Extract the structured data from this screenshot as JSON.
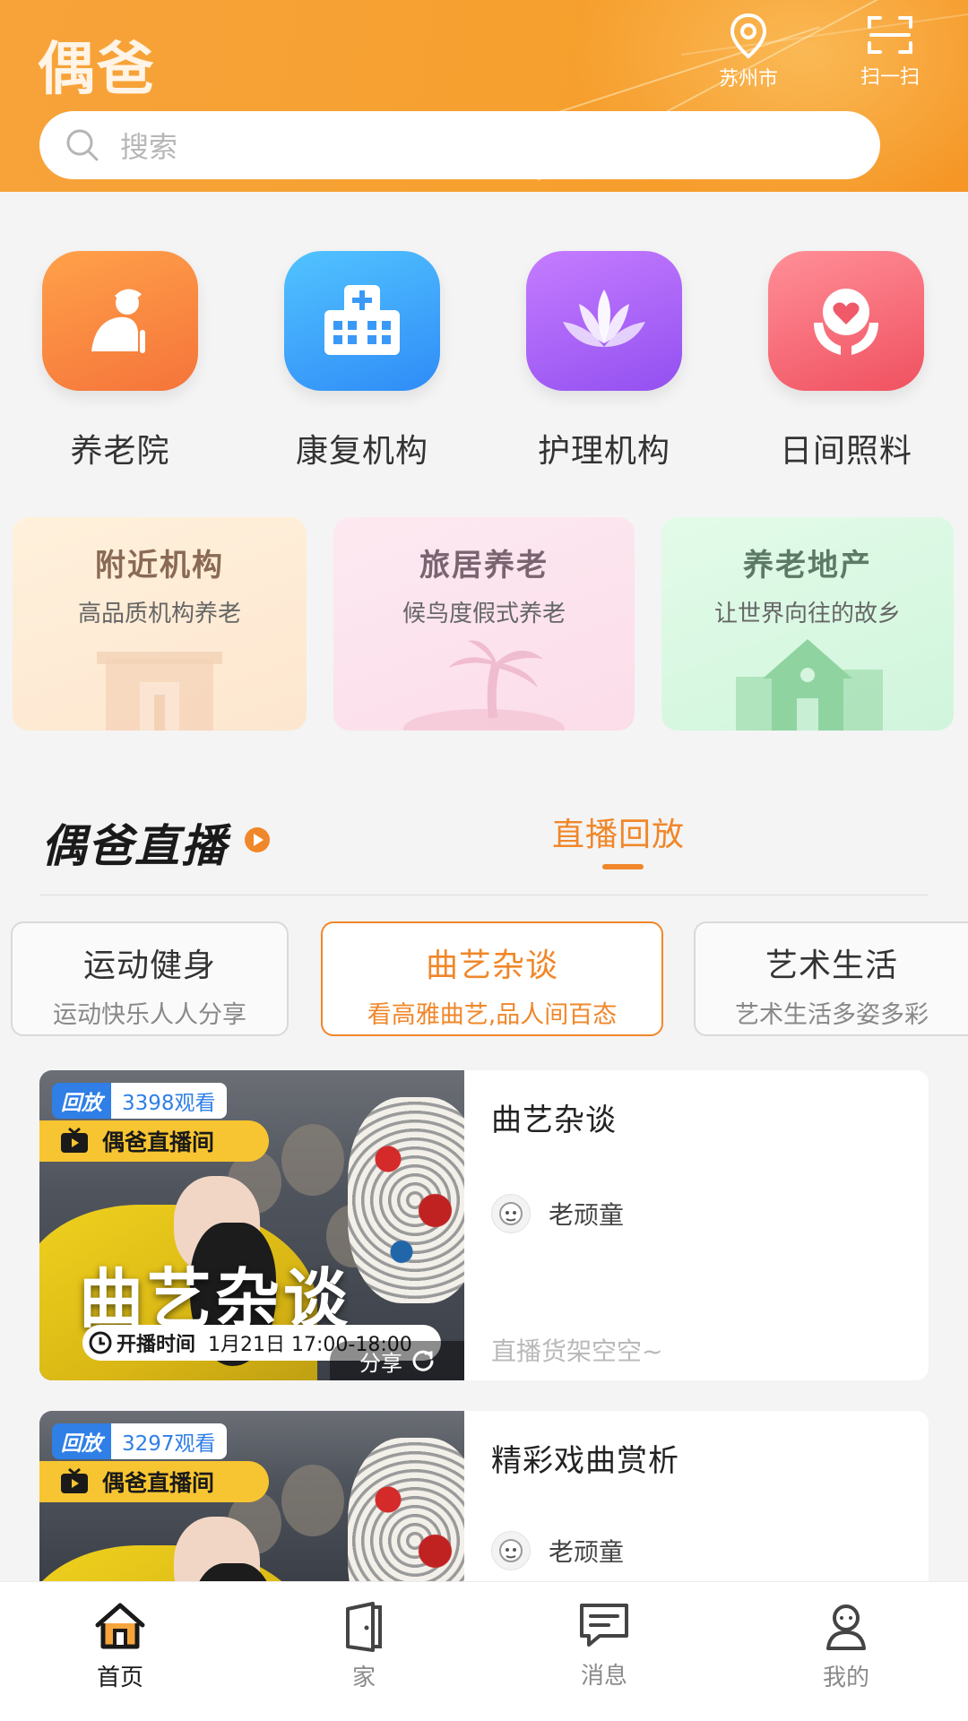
{
  "header": {
    "app_title": "偶爸",
    "location_label": "苏州市",
    "scan_label": "扫一扫",
    "search_placeholder": "搜索"
  },
  "categories": [
    {
      "label": "养老院",
      "icon": "elderly-person-icon"
    },
    {
      "label": "康复机构",
      "icon": "hospital-icon"
    },
    {
      "label": "护理机构",
      "icon": "lotus-icon"
    },
    {
      "label": "日间照料",
      "icon": "heart-hands-icon"
    }
  ],
  "features": [
    {
      "title": "附近机构",
      "subtitle": "高品质机构养老"
    },
    {
      "title": "旅居养老",
      "subtitle": "候鸟度假式养老"
    },
    {
      "title": "养老地产",
      "subtitle": "让世界向往的故乡"
    }
  ],
  "live": {
    "section_title": "偶爸直播",
    "tab_label": "直播回放",
    "pills": [
      {
        "title": "运动健身",
        "subtitle": "运动快乐人人分享",
        "active": false
      },
      {
        "title": "曲艺杂谈",
        "subtitle": "看高雅曲艺,品人间百态",
        "active": true
      },
      {
        "title": "艺术生活",
        "subtitle": "艺术生活多姿多彩",
        "active": false
      }
    ],
    "videos": [
      {
        "badge_replay": "回放",
        "views": "3398观看",
        "room": "偶爸直播间",
        "thumb_title": "曲艺杂谈",
        "time_label": "开播时间",
        "time_value": "1月21日 17:00-18:00",
        "share_label": "分享",
        "title": "曲艺杂谈",
        "host": "老顽童",
        "shelf": "直播货架空空~"
      },
      {
        "badge_replay": "回放",
        "views": "3297观看",
        "room": "偶爸直播间",
        "title": "精彩戏曲赏析",
        "host": "老顽童"
      }
    ]
  },
  "bottom_nav": [
    {
      "label": "首页",
      "icon": "home-icon",
      "active": true
    },
    {
      "label": "家",
      "icon": "door-icon",
      "active": false
    },
    {
      "label": "消息",
      "icon": "message-icon",
      "active": false
    },
    {
      "label": "我的",
      "icon": "profile-icon",
      "active": false
    }
  ],
  "colors": {
    "brand_orange": "#f6a02f",
    "accent": "#f0872a",
    "replay_blue": "#2f7fe6"
  }
}
